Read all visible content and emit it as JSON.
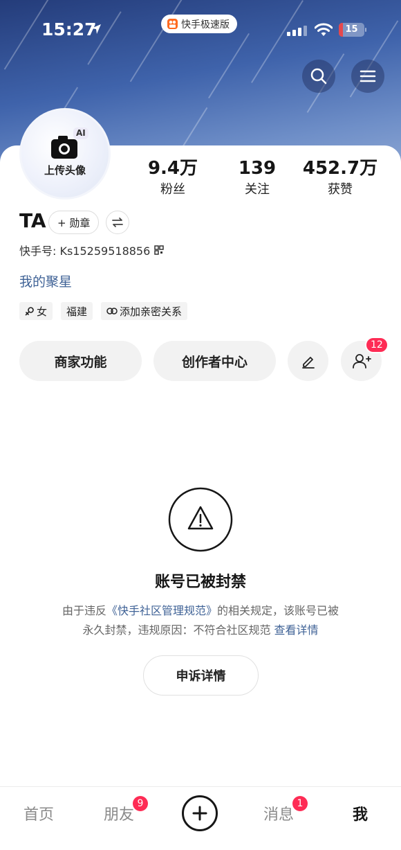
{
  "status_bar": {
    "time": "15:27",
    "app_name": "快手极速版",
    "battery_level": "15",
    "battery_fraction": 0.15
  },
  "header": {
    "search_icon": "search-icon",
    "menu_icon": "hamburger-menu-icon"
  },
  "profile": {
    "avatar_ai_label": "AI",
    "avatar_upload_label": "上传头像",
    "stats": [
      {
        "value": "9.4万",
        "label": "粉丝"
      },
      {
        "value": "139",
        "label": "关注"
      },
      {
        "value": "452.7万",
        "label": "获赞"
      }
    ],
    "username": "TA",
    "medal_label": "+ 勋章",
    "account_id": "快手号: Ks15259518856",
    "stars_link": "我的聚星",
    "tags": {
      "gender": "女",
      "location": "福建",
      "relation": "添加亲密关系"
    }
  },
  "actions": {
    "merchant": "商家功能",
    "creator_center": "创作者中心",
    "friend_requests_count": "12"
  },
  "ban_notice": {
    "title": "账号已被封禁",
    "desc_line1_prefix": "由于违反",
    "desc_line1_link": "《快手社区管理规范》",
    "desc_line1_suffix": "的相关规定，该账号已被",
    "desc_line2_prefix": "永久封禁，违规原因：不符合社区规范 ",
    "desc_line2_link": "查看详情",
    "appeal_button": "申诉详情"
  },
  "tabbar": {
    "home": "首页",
    "friends": "朋友",
    "friends_badge": "9",
    "messages": "消息",
    "messages_badge": "1",
    "me": "我"
  },
  "colors": {
    "accent_red": "#fe2c55",
    "link_blue": "#3f6296",
    "header_blue": "#3f63ab"
  }
}
